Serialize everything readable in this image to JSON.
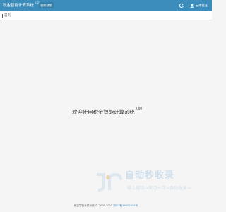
{
  "header": {
    "brand": "税金智能计算系统",
    "version": "2.00",
    "nav_button": "税收政策",
    "refresh_icon": "refresh-icon",
    "user_icon": "user-icon",
    "user_label": "云南营业"
  },
  "tabs": {
    "home": "首页"
  },
  "main": {
    "welcome": "欢迎使用税金智能计算系统",
    "version": "2.00"
  },
  "watermark": {
    "logo_text": "自动秒收录",
    "tagline": "做上链接→来访一次→自动收录→"
  },
  "footer": {
    "text": "税金智能计算系统 © 2016-2020",
    "link": "滇ICP备19002819号"
  },
  "colors": {
    "header_bg": "#3c8dbc",
    "nav_active_bg": "#367fa9",
    "page_bg": "#f5f5f5"
  }
}
